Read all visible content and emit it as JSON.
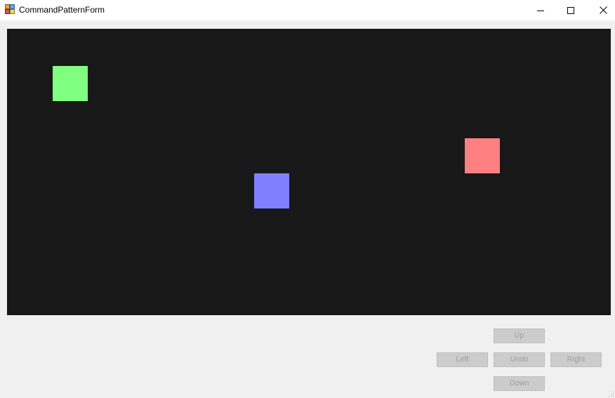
{
  "window": {
    "title": "CommandPatternForm",
    "icon": "winforms-app-icon"
  },
  "caption_buttons": {
    "minimize_icon": "minimize-icon",
    "maximize_icon": "maximize-icon",
    "close_icon": "close-icon"
  },
  "canvas": {
    "background": "#181818",
    "squares": [
      {
        "name": "green-square",
        "color": "#80ff80"
      },
      {
        "name": "red-square",
        "color": "#ff8080"
      },
      {
        "name": "blue-square",
        "color": "#8080ff"
      }
    ]
  },
  "controls": {
    "up_label": "Up",
    "left_label": "Left",
    "undo_label": "Undo",
    "right_label": "Right",
    "down_label": "Down",
    "enabled": false
  }
}
